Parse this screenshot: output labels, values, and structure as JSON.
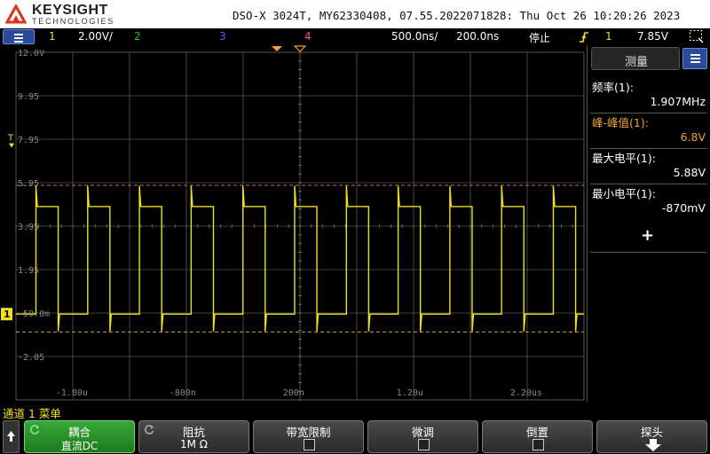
{
  "header": {
    "brand": "KEYSIGHT",
    "brand_sub": "TECHNOLOGIES",
    "model_info": "DSO-X 3024T, MY62330408, 07.55.2022071828: Thu Oct 26 10:20:26 2023"
  },
  "status": {
    "ch1_label": "1",
    "ch1_scale": "2.00V/",
    "ch2_label": "2",
    "ch3_label": "3",
    "ch4_label": "4",
    "timebase": "500.0ns/",
    "delay": "200.0ns",
    "run_state": "停止",
    "trigger_source": "1",
    "trigger_level": "7.85V"
  },
  "plot": {
    "y_ticks": [
      "12.0V",
      "9.95",
      "7.95",
      "5.95",
      "3.95",
      "1.95",
      "-50.0m",
      "-2.05"
    ],
    "x_ticks": [
      "-1.80u",
      "-800n",
      "200n",
      "1.20u",
      "2.20us"
    ],
    "trig_marker": "T",
    "ch_marker": "1",
    "colors": {
      "ch1": "#f0e020",
      "ch2": "#22c022",
      "ch3": "#4466ff",
      "ch4": "#ff44aa",
      "cursor_max": "#d07070",
      "cursor_min": "#e09a2a",
      "grid": "#555555"
    }
  },
  "panel": {
    "title": "测量",
    "measurements": [
      {
        "label": "频率(1):",
        "value": "1.907MHz",
        "color": "#ffffff"
      },
      {
        "label": "峰-峰值(1):",
        "value": "6.8V",
        "color": "#f0a030"
      },
      {
        "label": "最大电平(1):",
        "value": "5.88V",
        "color": "#ffffff"
      },
      {
        "label": "最小电平(1):",
        "value": "-870mV",
        "color": "#ffffff"
      }
    ],
    "add_label": "+"
  },
  "softkeys": {
    "menu_label": "通道 1 菜单",
    "keys": [
      {
        "title": "耦合",
        "value": "直流DC"
      },
      {
        "title": "阻抗",
        "value": "1M Ω"
      },
      {
        "title": "带宽限制",
        "value": ""
      },
      {
        "title": "微调",
        "value": ""
      },
      {
        "title": "倒置",
        "value": ""
      },
      {
        "title": "探头",
        "value": ""
      }
    ]
  },
  "icons": [
    "keysight-logo-icon",
    "menu-icon",
    "trigger-edge-icon",
    "screen-capture-icon",
    "back-arrow-icon",
    "cycle-icon",
    "down-arrow-icon"
  ]
}
